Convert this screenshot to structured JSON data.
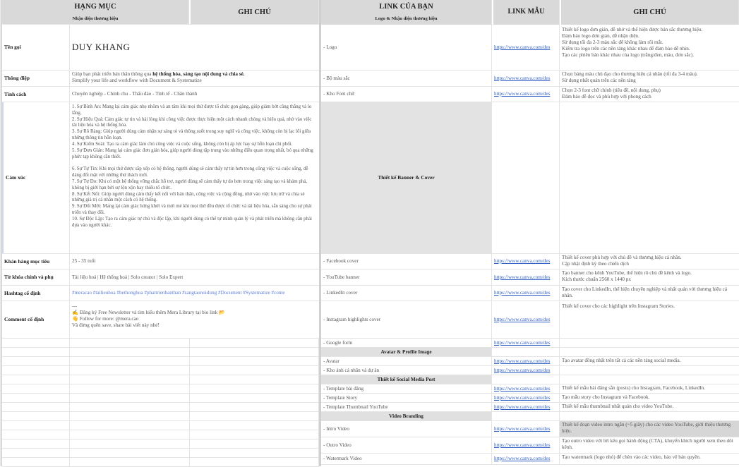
{
  "left": {
    "header": {
      "category": "HẠNG MỤC",
      "subcategory": "Nhận diện thương hiệu",
      "notes": "GHI CHÚ"
    },
    "rows": {
      "name": {
        "label": "Tên gọi",
        "value": "DUY KHANG"
      },
      "message": {
        "label": "Thông điệp",
        "line1_prefix": "Giúp bạn phát triển bản thân thông qua ",
        "line1_bold": "hệ thống hóa, sáng tạo nội dung và chia sẻ.",
        "line2": "Simplify your life and workflow with Document & Systematize"
      },
      "personality": {
        "label": "Tính cách",
        "value": "Chuyên nghiệp - Chỉnh chu - Thấu đáo - Tinh tế - Chân thành"
      },
      "emotion": {
        "label": "Cảm xúc",
        "text": "1. Sự Bình An: Mang lại cảm giác nhẹ nhõm và an tâm khi mọi thứ được tổ chức gọn gàng, giúp giảm bớt căng thẳng và lo lắng.\n2. Sự Hiệu Quả: Cảm giác tự tin và hài lòng khi công việc được thực hiện một cách nhanh chóng và hiệu quả, nhờ vào việc tài liệu hóa và hệ thống hóa.\n3. Sự Rõ Ràng: Giúp người dùng cảm nhận sự sáng tỏ và thông suốt trong suy nghĩ và công việc, không còn bị lạc lối giữa những thông tin hỗn loạn.\n4. Sự Kiểm Soát: Tạo ra cảm giác làm chủ công việc và cuộc sống, không còn bị áp lực hay sự hỗn loạn chi phối.\n5. Sự Đơn Giản: Mang lại cảm giác đơn giản hóa, giúp người dùng tập trung vào những điều quan trọng nhất, bỏ qua những phức tạp không cần thiết.\n\n6. Sự Tự Tin: Khi mọi thứ được sắp xếp có hệ thống, người dùng sẽ cảm thấy tự tin hơn trong công việc và cuộc sống, dễ dàng đối mặt với những thử thách mới.\n7. Sự Tự Do: Khi có một hệ thống vững chắc hỗ trợ, người dùng sẽ cảm thấy tự do hơn trong việc sáng tạo và khám phá, không bị giới hạn bởi sự lộn xộn hay thiếu tổ chức.\n8. Sự Kết Nối: Giúp người dùng cảm thấy kết nối với bản thân, công việc và cộng đồng, nhờ vào việc lưu trữ và chia sẻ những giá trị cá nhân một cách có hệ thống.\n9. Sự Đổi Mới: Mang lại cảm giác hứng khởi và mới mẻ khi mọi thứ đều được tổ chức và tài liệu hóa, sẵn sàng cho sự phát triển và thay đổi.\n10. Sự Độc Lập: Tạo ra cảm giác tự chủ và độc lập, khi người dùng có thể tự mình quản lý và phát triển mà không cần phải dựa vào người khác."
      },
      "audience": {
        "label": "Khán hàng mục tiêu",
        "value": "25 - 35 tuổi"
      },
      "keywords": {
        "label": "Từ khóa chính và phụ",
        "value": "Tài liệu hoá | Hệ thống hoá | Solo creator | Solo Expert"
      },
      "hashtags": {
        "label": "Hashtag cố định",
        "value": "#meracao #tailieuhoa #hethonghoa #phattrienbanthan #sangtaonoidung #Document #Systematize #conte"
      },
      "comment": {
        "label": "Comment cố định",
        "line1": "---",
        "line2": "✍️ Đăng ký Free Newsletter và tìm hiểu thêm Mera Library tại bio link 📂",
        "line3": "👋 Follow for more: @mera.cao",
        "line4": "Và đừng quên save, share bài viết này nhé!"
      }
    }
  },
  "right": {
    "header": {
      "link": "LINK CỦA BẠN",
      "sub": "Logo & Nhận diện thương hiệu",
      "sample": "LINK MẪU",
      "notes": "GHI CHÚ"
    },
    "url": "https://www.canva.com/des",
    "rows": [
      {
        "item": "- Logo",
        "note": "Thiết kế logo đơn giản, dễ nhớ và thể hiện được bản sắc thương hiệu.\nĐảm bảo logo đơn giản, dễ nhận diện.\nSử dụng tối đa 2-3 màu sắc để không làm rối mắt.\nKiểm tra logo trên các nền tảng khác nhau để đảm bảo dễ nhìn.\nTạo các phiên bản khác nhau của logo (trắng/đen, màu, đơn sắc)."
      },
      {
        "item": "- Bộ màu sắc",
        "note": "Chọn bảng màu chủ đạo cho thương hiệu cá nhân (tối đa 3-4 màu).\nSử dụng nhất quán trên các nền tảng"
      },
      {
        "item": "- Kho Font chữ",
        "note": "Chọn 2-3 font chữ chính (tiêu đề, nội dung, phụ)\nĐảm bảo dễ đọc và phù hợp với phong cách"
      },
      {
        "section": "Thiết kế Banner & Cover"
      },
      {
        "item": "- Facebook cover",
        "note": "Thiết kế cover phù hợp với chủ đề và thương hiệu cá nhân.\nCập nhật định kỳ theo chiến dịch"
      },
      {
        "item": "- YouTube banner",
        "note": "Tạo banner cho kênh YouTube, thể hiện rõ chủ đề kênh và logo.\nKích thước chuẩn 2560 x 1440 px"
      },
      {
        "item": "- LinkedIn cover",
        "note": "Tạo cover cho LinkedIn, thể hiện chuyên nghiệp và nhất quán với thương hiệu cá nhân."
      },
      {
        "item": "- Instagram highlights cover",
        "note": "Thiết kế cover cho các highlight trên Instagram Stories."
      },
      {
        "item": "- Google form",
        "note": ""
      },
      {
        "section": "Avatar & Profile Image"
      },
      {
        "item": "- Avatar",
        "note": "Tạo avatar đồng nhất trên tất cả các nền tảng social media."
      },
      {
        "item": "- Kho ảnh cá nhân và dự án",
        "note": ""
      },
      {
        "section": "Thiết kế Social Media Post"
      },
      {
        "item": "- Template bài đăng",
        "note": "Thiết kế mẫu bài đăng sẵn (posts) cho Instagram, Facebook, LinkedIn."
      },
      {
        "item": "- Template Story",
        "note": "Tạo mẫu story cho Instagram và Facebook."
      },
      {
        "item": "- Template Thumbnail YouTube",
        "note": "Thiết kế mẫu thumbnail nhất quán cho video YouTube."
      },
      {
        "section": "Video Branding"
      },
      {
        "item": "- Intro Video",
        "note": "Thiết kế đoạn video intro ngắn (~5 giây) cho các video YouTube, giới thiệu thương hiệu."
      },
      {
        "item": "- Outro Video",
        "note": "Tạo outro video với lời kêu gọi hành động (CTA), khuyến khích người xem theo dõi kênh."
      },
      {
        "item": "- Watermark Video",
        "note": "Tạo watermark (logo nhỏ) để chèn vào các video, bảo vệ bản quyền."
      }
    ]
  }
}
